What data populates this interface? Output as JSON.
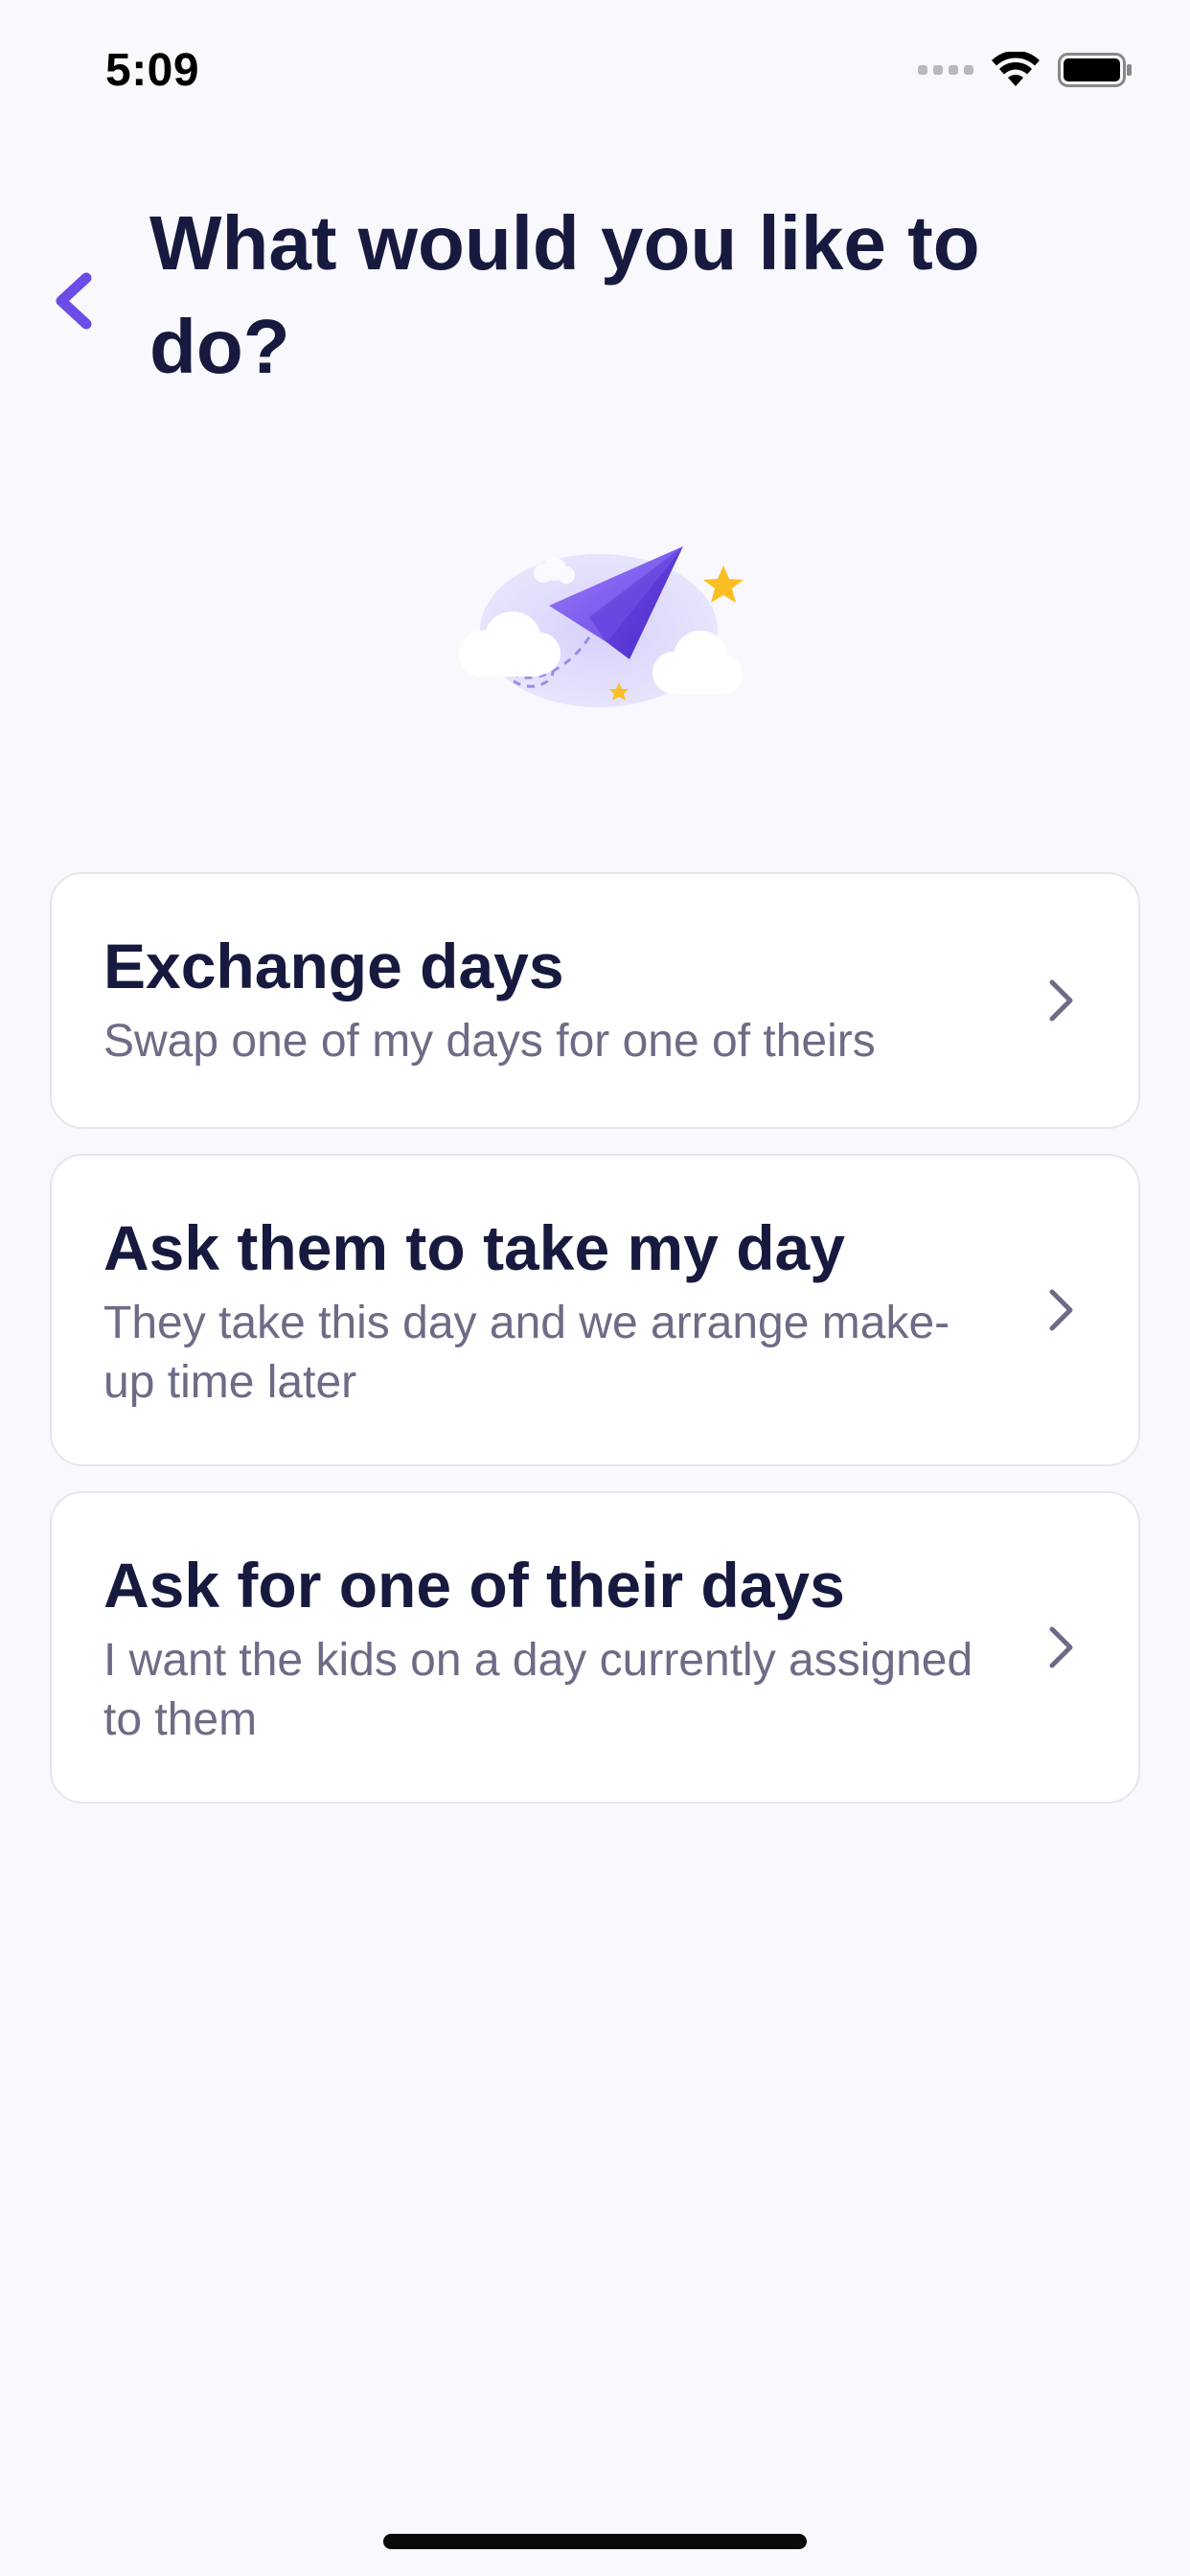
{
  "status_bar": {
    "time": "5:09"
  },
  "header": {
    "back_icon": "chevron-left-icon",
    "title": "What would you like to do?"
  },
  "illustration": {
    "name": "paper-plane-clouds-illustration"
  },
  "options": [
    {
      "title": "Exchange days",
      "description": "Swap one of my days for one of theirs"
    },
    {
      "title": "Ask them to take my day",
      "description": "They take this day and we arrange make-up time later"
    },
    {
      "title": "Ask for one of their days",
      "description": "I want the kids on a day currently assigned to them"
    }
  ],
  "colors": {
    "background": "#F8F8FD",
    "accent": "#6C4CE6",
    "title_text": "#171A3E",
    "secondary_text": "#6C6C86",
    "card_border": "#E6E6EE"
  }
}
